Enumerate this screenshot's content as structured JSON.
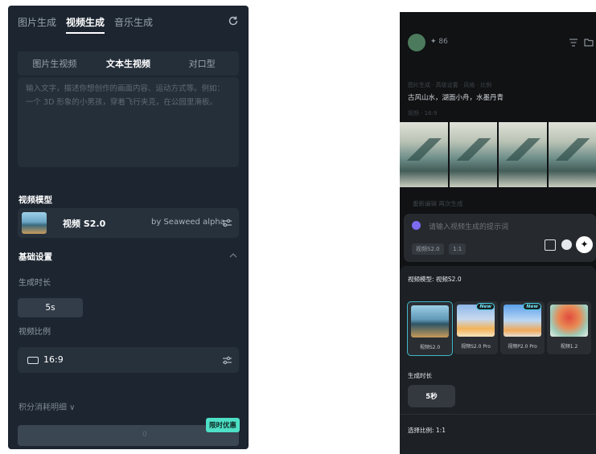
{
  "left": {
    "topnav": [
      "图片生成",
      "视频生成",
      "音乐生成"
    ],
    "topnav_active": 1,
    "subtabs": [
      "图片生视频",
      "文本生视频",
      "对口型"
    ],
    "subtabs_active": 1,
    "prompt_placeholder": "输入文字，描述你想创作的画面内容、运动方式等。例如：一个 3D 形象的小男孩，穿着飞行夹克，在公园里滑板。",
    "section_video_model": "视频模型",
    "model_name": "视频 S2.0",
    "model_by": "by Seaweed alpha",
    "section_basic": "基础设置",
    "duration_label": "生成时长",
    "duration_value": "5s",
    "ratio_label": "视频比例",
    "ratio_value": "16:9",
    "credits_label": "积分消耗明细 ∨",
    "promo_badge": "限时优惠",
    "generate_label": "0"
  },
  "right": {
    "points": "86",
    "faint_line_1": "图片生成 · 高级设置 · 风格 · 比例",
    "prompt_title": "古风山水，湖面小舟，水墨丹青",
    "faint_line_2": "视频 · 16:9",
    "actions": "重新编辑   再次生成",
    "composer_placeholder": "请输入视频生成的提示词",
    "chips": [
      "视频S2.0",
      "1:1"
    ],
    "model_section": "视频模型: 视频S2.0",
    "models": [
      {
        "name": "视频S2.0",
        "new": false,
        "selected": true,
        "art": "linear-gradient(180deg,#9ccfe6 0%,#5f97b5 45%,#2f5566 58%,#c79a58 100%)"
      },
      {
        "name": "视频S2.0 Pro",
        "new": true,
        "selected": false,
        "art": "linear-gradient(180deg,#8fb8e8 0%,#c7d9ef 45%,#f2b35a 75%,#f6e4c0 100%)"
      },
      {
        "name": "视频P2.0 Pro",
        "new": true,
        "selected": false,
        "art": "linear-gradient(180deg,#5aa0ea 0%,#bcd7f3 50%,#f0a95a 80%,#e8e0d4 100%)"
      },
      {
        "name": "视频1.2",
        "new": false,
        "selected": false,
        "art": "radial-gradient(circle at 50% 40%,#e14b3d 0%,#e88a55 40%,#9ecbb8 70%,#e9efe9 100%)"
      }
    ],
    "new_badge": "New",
    "duration_section": "生成时长",
    "duration_value": "5秒",
    "ratio_section": "选择比例: 1:1"
  }
}
